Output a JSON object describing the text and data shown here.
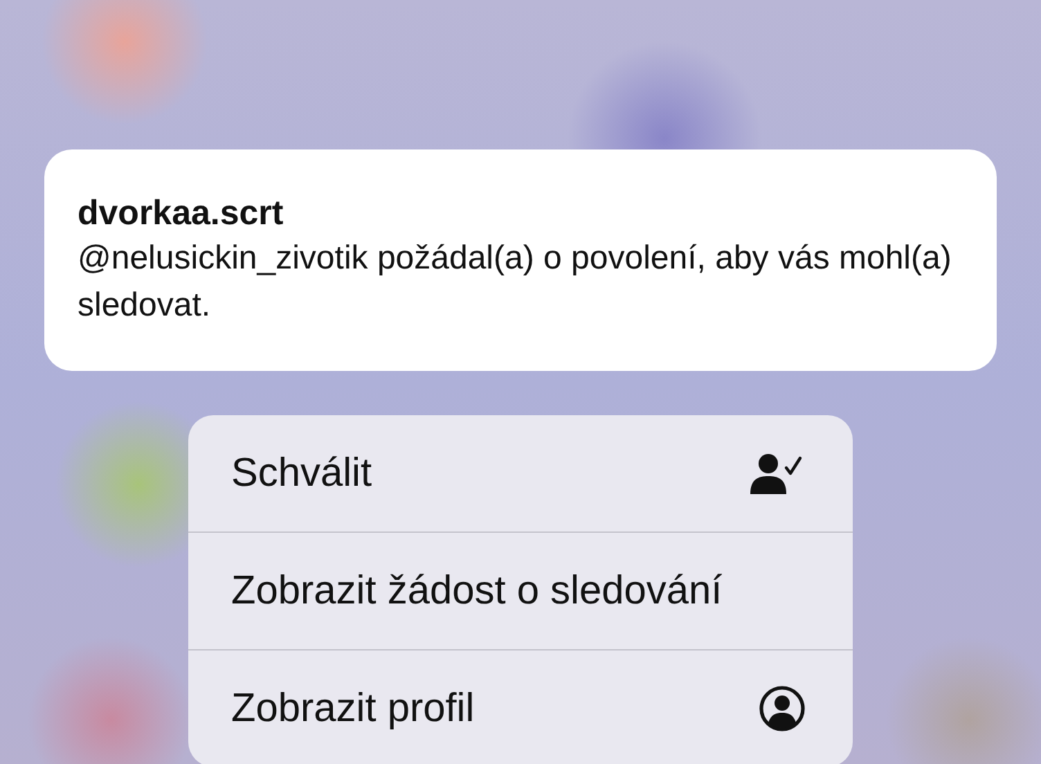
{
  "notification": {
    "title": "dvorkaa.scrt",
    "body": "@nelusickin_zivotik požádal(a) o povolení, aby vás mohl(a) sledovat."
  },
  "menu": [
    {
      "label": "Schválit",
      "kind": "approve"
    },
    {
      "label": "Zobrazit žádost o sledování",
      "kind": "plain"
    },
    {
      "label": "Zobrazit profil",
      "kind": "profile"
    }
  ]
}
